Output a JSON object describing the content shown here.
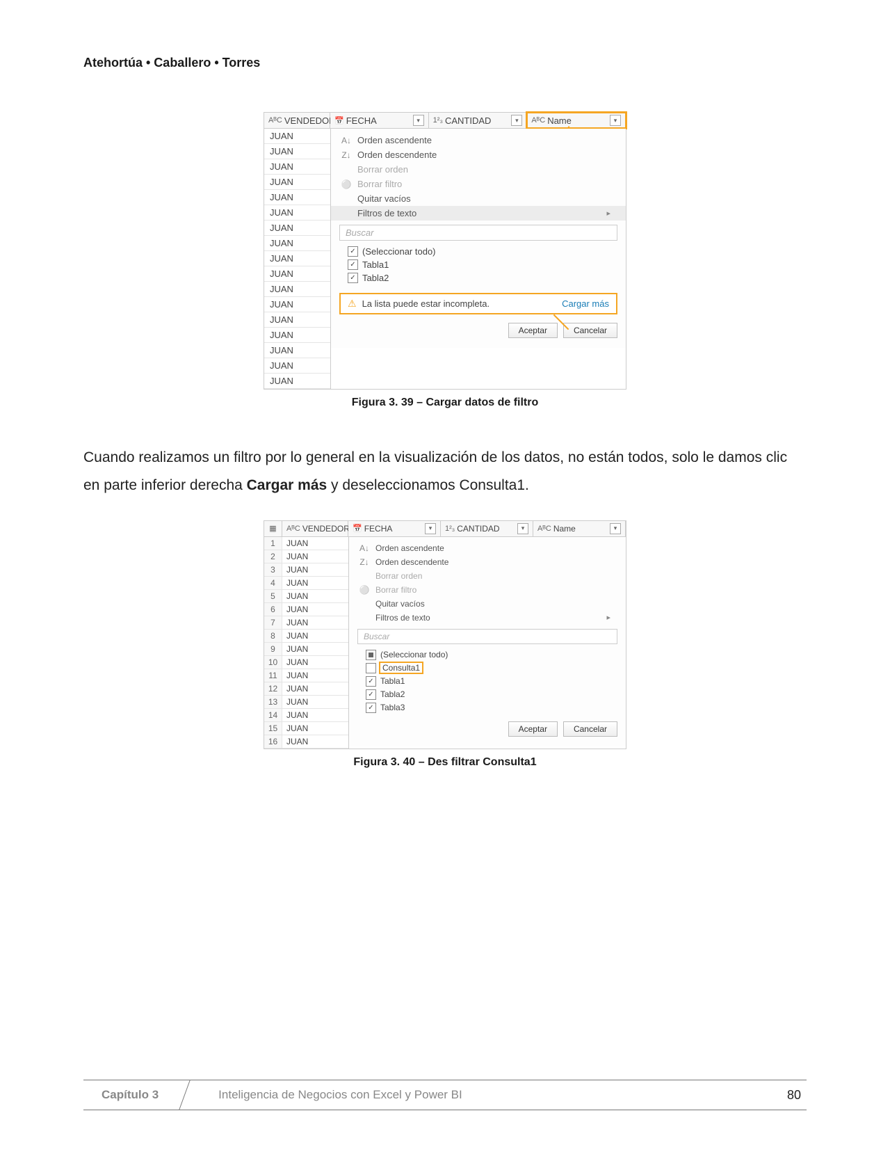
{
  "header": {
    "authors": "Atehortúa • Caballero • Torres"
  },
  "fig1": {
    "cols": {
      "vendedor": "VENDEDOR",
      "fecha": "FECHA",
      "cantidad": "CANTIDAD",
      "name": "Name",
      "abc_prefix": "AᴮC",
      "num_prefix": "1²₃"
    },
    "rows": [
      "JUAN",
      "JUAN",
      "JUAN",
      "JUAN",
      "JUAN",
      "JUAN",
      "JUAN",
      "JUAN",
      "JUAN",
      "JUAN",
      "JUAN",
      "JUAN",
      "JUAN",
      "JUAN",
      "JUAN",
      "JUAN",
      "JUAN"
    ],
    "menu": {
      "asc": "Orden ascendente",
      "desc": "Orden descendente",
      "clear_sort": "Borrar orden",
      "clear_filter": "Borrar filtro",
      "remove_empty": "Quitar vacíos",
      "text_filters": "Filtros de texto",
      "search_placeholder": "Buscar",
      "select_all": "(Seleccionar todo)",
      "items": [
        "Tabla1",
        "Tabla2"
      ],
      "warn_text": "La lista puede estar incompleta.",
      "load_more": "Cargar más",
      "accept": "Aceptar",
      "cancel": "Cancelar"
    },
    "caption": "Figura 3. 39 – Cargar datos de filtro"
  },
  "body_text": {
    "p1a": "Cuando realizamos un filtro por lo general en la visualización de los datos, no están todos, solo le damos clic en parte inferior derecha ",
    "p1b": "Cargar más",
    "p1c": " y deseleccionamos Consulta1."
  },
  "fig2": {
    "row_nums": [
      "1",
      "2",
      "3",
      "4",
      "5",
      "6",
      "7",
      "8",
      "9",
      "10",
      "11",
      "12",
      "13",
      "14",
      "15",
      "16"
    ],
    "rows": [
      "JUAN",
      "JUAN",
      "JUAN",
      "JUAN",
      "JUAN",
      "JUAN",
      "JUAN",
      "JUAN",
      "JUAN",
      "JUAN",
      "JUAN",
      "JUAN",
      "JUAN",
      "JUAN",
      "JUAN",
      "JUAN"
    ],
    "menu": {
      "asc": "Orden ascendente",
      "desc": "Orden descendente",
      "clear_sort": "Borrar orden",
      "clear_filter": "Borrar filtro",
      "remove_empty": "Quitar vacíos",
      "text_filters": "Filtros de texto",
      "search_placeholder": "Buscar",
      "select_all": "(Seleccionar todo)",
      "consulta": "Consulta1",
      "items": [
        "Tabla1",
        "Tabla2",
        "Tabla3"
      ],
      "accept": "Aceptar",
      "cancel": "Cancelar"
    },
    "caption": "Figura 3. 40 – Des filtrar Consulta1"
  },
  "footer": {
    "chapter": "Capítulo 3",
    "title": "Inteligencia de Negocios con Excel y Power BI",
    "page": "80"
  }
}
